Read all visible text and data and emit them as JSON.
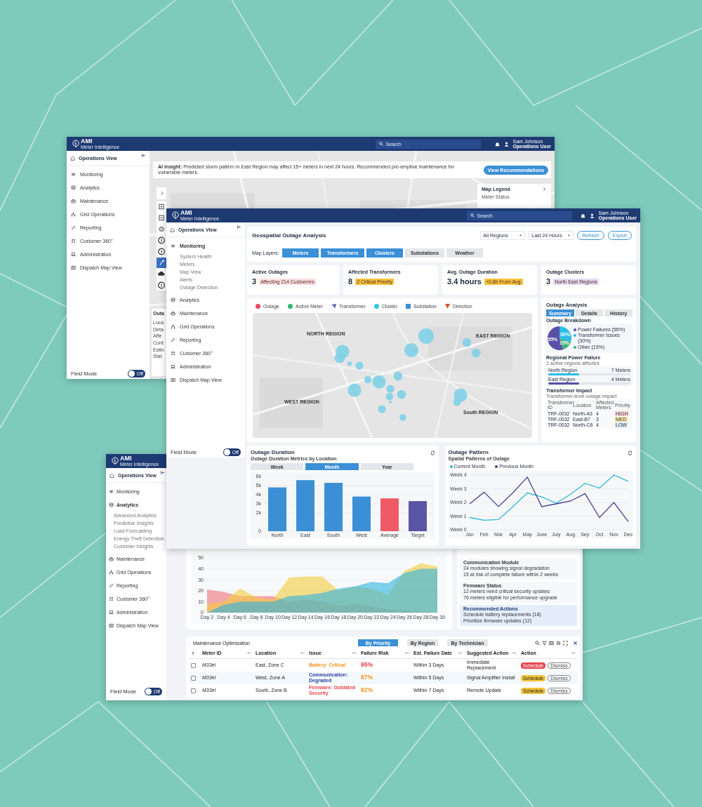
{
  "background_window": {
    "header": {
      "logo": "AMI",
      "tagline": "Meter Intelligence",
      "search_placeholder": "Search",
      "user_name": "Sam Johnson",
      "user_role": "Operations User"
    },
    "sidebar": {
      "title": "Operations View",
      "items": [
        {
          "label": "Monitoring",
          "expanded": false
        },
        {
          "label": "Analytics",
          "expanded": false
        },
        {
          "label": "Maintenance",
          "expanded": false
        },
        {
          "label": "Grid Operations",
          "expanded": false
        },
        {
          "label": "Reporting",
          "expanded": false
        },
        {
          "label": "Customer 360°",
          "expanded": false
        },
        {
          "label": "Administration",
          "expanded": false
        },
        {
          "label": "Dispatch Map View",
          "expanded": false
        }
      ],
      "field_mode": {
        "label": "Field Mode",
        "on": false,
        "toggle_text": "Off"
      }
    },
    "insight": {
      "text": "**AI Insight:** Predicted storm pattern in East Region may affect 15+ meters in next 24 hours. Recommended pre-emptive maintenance for vulnerable meters.",
      "button": "View Recommendations"
    },
    "map_legend": {
      "title": "Map Legend",
      "subtitle": "Meter Status"
    },
    "side_panel": {
      "title": "Outa",
      "rows": [
        "Loca",
        "Deta",
        "Affe",
        "Cont",
        "Estin",
        "Stat"
      ]
    }
  },
  "main_window": {
    "header": {
      "logo": "AMI",
      "tagline": "Meter Intelligence",
      "search_placeholder": "Search",
      "user_name": "Sam Johnson",
      "user_role": "Operations User"
    },
    "sidebar": {
      "title": "Operations View",
      "items": [
        {
          "label": "Monitoring",
          "expanded": true,
          "children": [
            {
              "label": "System Health"
            },
            {
              "label": "Meters"
            },
            {
              "label": "Map View"
            },
            {
              "label": "Alerts"
            },
            {
              "label": "Outage Detection"
            }
          ]
        },
        {
          "label": "Analytics",
          "expanded": false
        },
        {
          "label": "Maintenance",
          "expanded": false
        },
        {
          "label": "Grid Operations",
          "expanded": false
        },
        {
          "label": "Reporting",
          "expanded": false
        },
        {
          "label": "Customer 360°",
          "expanded": false
        },
        {
          "label": "Administration",
          "expanded": false
        },
        {
          "label": "Dispatch Map View",
          "expanded": false
        }
      ],
      "field_mode": {
        "label": "Field Mode",
        "on": false,
        "toggle_text": "Off"
      }
    },
    "analysis": {
      "title": "Geospatial Outage Analysis",
      "selects": [
        "All Regions",
        "Last 24 Hours"
      ],
      "buttons": [
        "Refresh",
        "Export"
      ],
      "layers_label": "Map Layers:",
      "layers": [
        {
          "label": "Meters",
          "on": true
        },
        {
          "label": "Transformers",
          "on": true
        },
        {
          "label": "Clusters",
          "on": true
        },
        {
          "label": "Substations",
          "on": false
        },
        {
          "label": "Weather",
          "on": false
        }
      ]
    },
    "stats": [
      {
        "title": "Active Outages",
        "value": "3",
        "badge": "Affecting 214 Custoemrs",
        "color": "#fbe0e0"
      },
      {
        "title": "Affected Transformers",
        "value": "8",
        "badge": "2 Critical Priority",
        "color": "#f5c43c"
      },
      {
        "title": "Avg. Outage Duration",
        "value": "3.4 hours",
        "badge": "+0.8h From Avg.",
        "color": "#f5c43c"
      },
      {
        "title": "Outage Clusters",
        "value": "3",
        "badge": "North East Regions",
        "color": "#e2dcf4"
      }
    ],
    "map": {
      "legend": [
        {
          "label": "Outage",
          "kind": "circle",
          "color": "#e84a5f"
        },
        {
          "label": "Active Meter",
          "kind": "circle",
          "color": "#2fb37a"
        },
        {
          "label": "Transformer",
          "kind": "arrow",
          "color": "#4a55a8"
        },
        {
          "label": "Cluster",
          "kind": "circle",
          "color": "#35c3e8"
        },
        {
          "label": "Substation",
          "kind": "square",
          "color": "#3a8fd6"
        },
        {
          "label": "Direction",
          "kind": "triangle",
          "color": "#e0512d"
        }
      ],
      "regions": [
        "NORTH REGION",
        "EAST REGION",
        "WEST REGION",
        "South REGION"
      ]
    },
    "outage_analysis": {
      "title": "Outage Analysis",
      "tabs": [
        {
          "label": "Summary",
          "selected": true
        },
        {
          "label": "Details",
          "selected": false
        },
        {
          "label": "History",
          "selected": false
        }
      ],
      "breakdown_title": "Outage Breakdown",
      "chart_data": {
        "type": "pie",
        "categories": [
          "Power Failures (55%)",
          "Transformer Issues (30%)",
          "Other (15%)"
        ],
        "values": [
          55,
          30,
          15
        ],
        "value_labels": [
          "55%",
          "30%",
          "15%"
        ],
        "colors": [
          "#5b4fa8",
          "#2bbde6",
          "#3fb07a"
        ]
      },
      "regional_title": "Regional Power Failure",
      "regional_subtitle": "2 active regions affected",
      "regions": [
        {
          "name": "North Region",
          "count": "7 Meters",
          "level": 0.38,
          "color": "#2bbde6"
        },
        {
          "name": "East Region",
          "count": "4 Meters",
          "level": 0.38,
          "color": "#5b4fa8"
        }
      ],
      "impact_title": "Transformer Impact",
      "impact_subtitle": "Transformer-level outage impact",
      "impact_columns": [
        "Transformer ID",
        "Location",
        "Affected Meters",
        "Priority"
      ],
      "impact_rows": [
        {
          "id": "TRF-0032",
          "location": "North-A3",
          "meters": "4",
          "priority": "HIGH",
          "color": "#fbd3d6"
        },
        {
          "id": "TRF-0032",
          "location": "East-B7",
          "meters": "3",
          "priority": "MED",
          "color": "#fbe7a6"
        },
        {
          "id": "TRF-0032",
          "location": "North-C6",
          "meters": "4",
          "priority": "LOW",
          "color": "#d6e6f7"
        }
      ]
    },
    "duration": {
      "title": "Outage Duration",
      "subtitle": "Outage Duration Metrics by Location",
      "tabs": [
        {
          "label": "Week",
          "selected": false
        },
        {
          "label": "Month",
          "selected": true
        },
        {
          "label": "Year",
          "selected": false
        }
      ],
      "chart_data": {
        "type": "bar",
        "grid": true,
        "categories": [
          "North",
          "East",
          "South",
          "West",
          "Average",
          "Target"
        ],
        "values": [
          4800,
          5600,
          5300,
          3800,
          3600,
          3300
        ],
        "colors": [
          "#3b8fd4",
          "#3b8fd4",
          "#3b8fd4",
          "#3b8fd4",
          "#ef5a64",
          "#5b55a6"
        ],
        "ylim": [
          0,
          6000
        ],
        "yticks": [
          {
            "value": 0,
            "label": "0"
          },
          {
            "value": 2000,
            "label": "2k"
          },
          {
            "value": 3000,
            "label": "3k"
          },
          {
            "value": 4000,
            "label": "4k"
          },
          {
            "value": 5000,
            "label": "5k"
          },
          {
            "value": 6000,
            "label": "6k"
          }
        ]
      }
    },
    "pattern": {
      "title": "Outage Pattern",
      "subtitle": "Spatial Patterns of Outage",
      "chart": {
        "x_labels": [
          "Jan",
          "Feb",
          "Mar",
          "Apr",
          "May",
          "June",
          "July",
          "Aug",
          "Sep",
          "Oct",
          "Nov",
          "Dec"
        ],
        "series": [
          {
            "name": "Current Month",
            "color": "#2bb8d8"
          },
          {
            "name": "Previous Month",
            "color": "#4b3f8f"
          }
        ],
        "y_labels": [
          "Week 4",
          "Week 3",
          "Week 2",
          "Week 1",
          "Week 0"
        ]
      }
    }
  },
  "front_window": {
    "header": {
      "logo": "AMI",
      "tagline": "Meter Intelligence"
    },
    "sidebar": {
      "title": "Operations View",
      "items": [
        {
          "label": "Monitoring",
          "expanded": false
        },
        {
          "label": "Analytics",
          "expanded": true,
          "children": [
            {
              "label": "Advanced Analytics"
            },
            {
              "label": "Predictive Insights"
            },
            {
              "label": "Load Forecasting"
            },
            {
              "label": "Energy Theft Detection"
            },
            {
              "label": "Customer Insights"
            }
          ]
        },
        {
          "label": "Maintenance",
          "expanded": false
        },
        {
          "label": "Grid Operations",
          "expanded": false
        },
        {
          "label": "Reporting",
          "expanded": false
        },
        {
          "label": "Customer 360°",
          "expanded": false
        },
        {
          "label": "Administration",
          "expanded": false
        },
        {
          "label": "Dispatch Map View",
          "expanded": false
        }
      ],
      "field_mode": {
        "label": "Field Mode",
        "on": false,
        "toggle_text": "Off"
      }
    },
    "trend": {
      "chart_data": {
        "type": "area",
        "grid": true,
        "categories": [
          "Day 2",
          "Day 4",
          "Day 6",
          "Day 8",
          "Day 10",
          "Day 12",
          "Day 14",
          "Day 16",
          "Day 18",
          "Day 20",
          "Day 22",
          "Day 24",
          "Day 26",
          "Day 28",
          "Day 30"
        ],
        "series": [
          {
            "color": "#ef6f7a",
            "values": [
              21,
              19,
              15,
              15,
              15,
              10,
              12,
              10,
              6,
              8,
              6,
              3,
              2,
              1,
              0
            ]
          },
          {
            "color": "#f3cb3c",
            "values": [
              8,
              10,
              22,
              14,
              12,
              32,
              33,
              33,
              20,
              24,
              22,
              16,
              38,
              45,
              42
            ]
          },
          {
            "color": "#2bb3e0",
            "values": [
              0,
              7,
              10,
              10,
              10,
              15,
              16,
              18,
              22,
              24,
              28,
              27,
              36,
              40,
              40
            ]
          }
        ],
        "ylim": [
          0,
          50
        ],
        "yticks": [
          0,
          10,
          20,
          30,
          40,
          50
        ]
      }
    },
    "modules": [
      {
        "title": "Communication Module",
        "lines": [
          "24 modules showing signal degradation",
          "15 at risk of complete failure within 2 weeks"
        ],
        "highlighted": false
      },
      {
        "title": "Firmware Status",
        "lines": [
          "12 meters need critical security updates",
          "76 meters eligible for performance upgrade"
        ],
        "highlighted": false
      },
      {
        "title": "Recommended Actions",
        "lines": [
          "Schedule battery replacements (18)",
          "Prioritize firmware updates (12)"
        ],
        "highlighted": true
      }
    ],
    "table": {
      "title": "Maintenance Optimization",
      "tabs": [
        {
          "label": "By Priority",
          "selected": true
        },
        {
          "label": "By Region",
          "selected": false
        },
        {
          "label": "By Technician",
          "selected": false
        }
      ],
      "columns": [
        "Meter ID",
        "Location",
        "Issue",
        "Failure Risk",
        "Est. Failure Date",
        "Suggested Action",
        "Action"
      ],
      "rows": [
        {
          "checked": false,
          "meter_id": "M33el",
          "location": "East, Zone C",
          "issue": {
            "text": "Battery: Critical",
            "color": "#f0961e"
          },
          "risk": {
            "text": "95%",
            "color": "#e53945"
          },
          "date": "Within 3 Days",
          "action": "Immediate Replacement",
          "schedule": {
            "label": "Schedule",
            "color": "#e8454f"
          },
          "dismiss": "Dismiss"
        },
        {
          "checked": false,
          "meter_id": "M33el",
          "location": "West, Zone A",
          "issue": {
            "text": "Communication: Degraded",
            "color": "#3040a0"
          },
          "risk": {
            "text": "87%",
            "color": "#f0961e"
          },
          "date": "Within 5 Days",
          "action": "Signal Amplifier Install",
          "schedule": {
            "label": "Schedule",
            "color": "#f5c43c"
          },
          "dismiss": "Dismiss"
        },
        {
          "checked": false,
          "meter_id": "M33el",
          "location": "South, Zone B",
          "issue": {
            "text": "Firmware: Outdated Security",
            "color": "#e8454f"
          },
          "risk": {
            "text": "82%",
            "color": "#f0961e"
          },
          "date": "Within 7 Days",
          "action": "Remote Update",
          "schedule": {
            "label": "Schedule",
            "color": "#f5c43c"
          },
          "dismiss": "Dismiss"
        }
      ]
    }
  }
}
